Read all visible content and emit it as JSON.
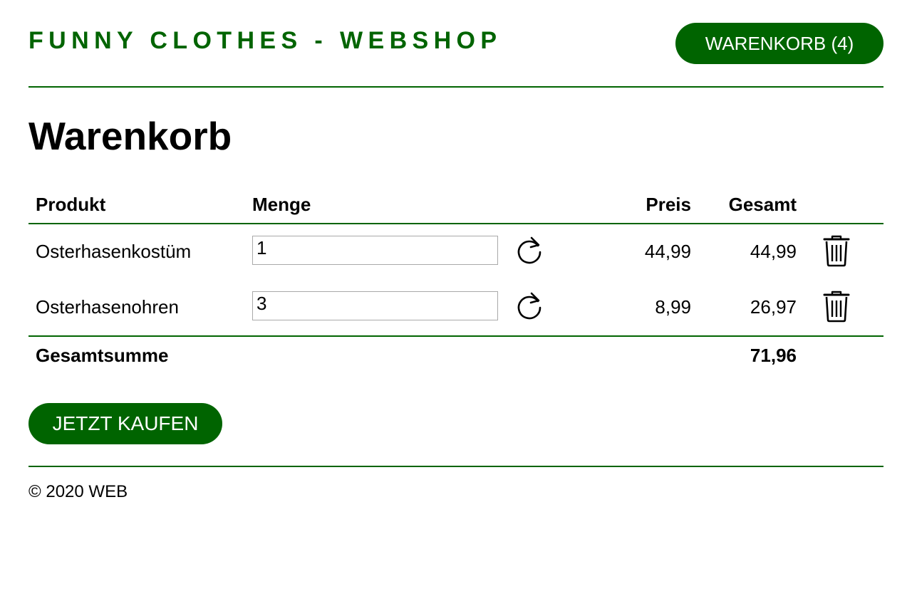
{
  "header": {
    "brand": "FUNNY CLOTHES - WEBSHOP",
    "cart_button_label": "WARENKORB (4)"
  },
  "main": {
    "title": "Warenkorb",
    "table": {
      "columns": {
        "product": "Produkt",
        "quantity": "Menge",
        "price": "Preis",
        "total": "Gesamt"
      },
      "rows": [
        {
          "product": "Osterhasenkostüm",
          "quantity": "1",
          "price": "44,99",
          "total": "44,99"
        },
        {
          "product": "Osterhasenohren",
          "quantity": "3",
          "price": "8,99",
          "total": "26,97"
        }
      ],
      "sum_label": "Gesamtsumme",
      "sum_value": "71,96"
    },
    "buy_button_label": "JETZT KAUFEN"
  },
  "footer": {
    "copyright": "© 2020 WEB"
  },
  "icons": {
    "refresh": "refresh-icon",
    "delete": "trash-icon"
  },
  "colors": {
    "accent": "#006400",
    "button_text": "#ffffff",
    "input_border": "#a9a9a9"
  }
}
